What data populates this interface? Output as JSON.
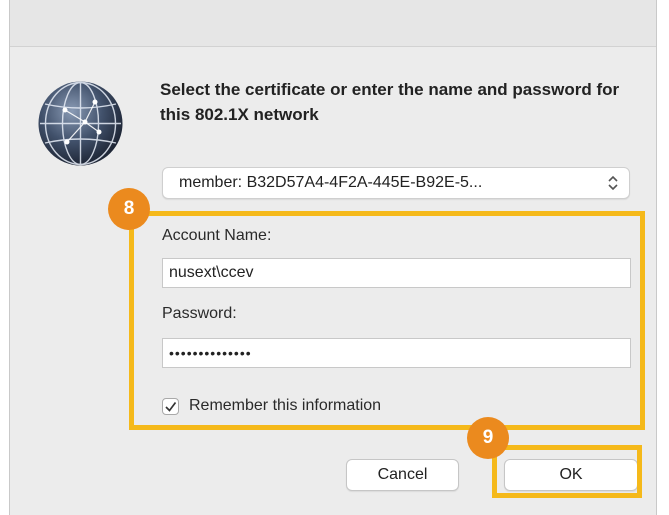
{
  "dialog": {
    "heading": "Select the certificate or enter the name and password for this 802.1X network",
    "certificate_select": {
      "value": "member: B32D57A4-4F2A-445E-B92E-5..."
    },
    "account_name": {
      "label": "Account Name:",
      "value": "nusext\\ccev"
    },
    "password": {
      "label": "Password:",
      "value": "••••••••••••••"
    },
    "remember": {
      "label": "Remember this information",
      "checked": true
    },
    "buttons": {
      "cancel": "Cancel",
      "ok": "OK"
    }
  },
  "annotations": [
    {
      "number": "8",
      "color": "#eb8a1e"
    },
    {
      "number": "9",
      "color": "#eb8a1e"
    }
  ],
  "highlight_color": "#f5b91a",
  "icons": {
    "network": "globe-network-icon",
    "select_arrow": "chevron-updown-icon",
    "checkbox": "checkmark-icon"
  }
}
